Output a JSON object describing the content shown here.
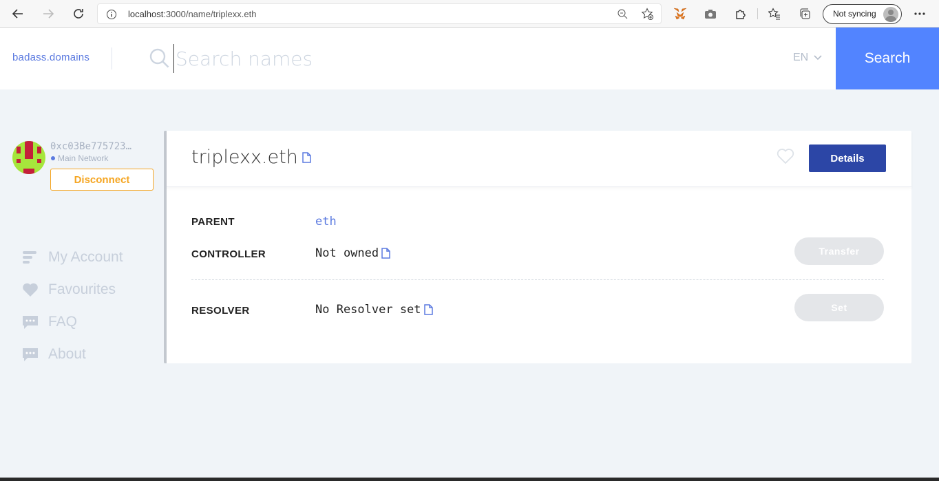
{
  "browser": {
    "url_host": "localhost",
    "url_path": ":3000/name/triplexx.eth",
    "sync_status": "Not syncing"
  },
  "header": {
    "brand": "badass.domains",
    "search_placeholder": "Search names",
    "language": "EN",
    "search_button": "Search"
  },
  "sidebar": {
    "account_address": "0xc03Be775723…",
    "network": "Main Network",
    "disconnect_label": "Disconnect",
    "items": [
      {
        "label": "My Account",
        "icon": "account-list-icon"
      },
      {
        "label": "Favourites",
        "icon": "heart-icon"
      },
      {
        "label": "FAQ",
        "icon": "chat-icon"
      },
      {
        "label": "About",
        "icon": "chat-icon"
      }
    ]
  },
  "domain": {
    "name": "triplexx.eth",
    "details_label": "Details",
    "rows": {
      "parent": {
        "label": "PARENT",
        "value": "eth"
      },
      "controller": {
        "label": "CONTROLLER",
        "value": "Not owned",
        "action": "Transfer"
      },
      "resolver": {
        "label": "RESOLVER",
        "value": "No Resolver set",
        "action": "Set"
      }
    }
  },
  "colors": {
    "accent": "#5284ff",
    "brand": "#5b7ae0",
    "details": "#2c46a6",
    "disconnect": "#f5a623"
  }
}
